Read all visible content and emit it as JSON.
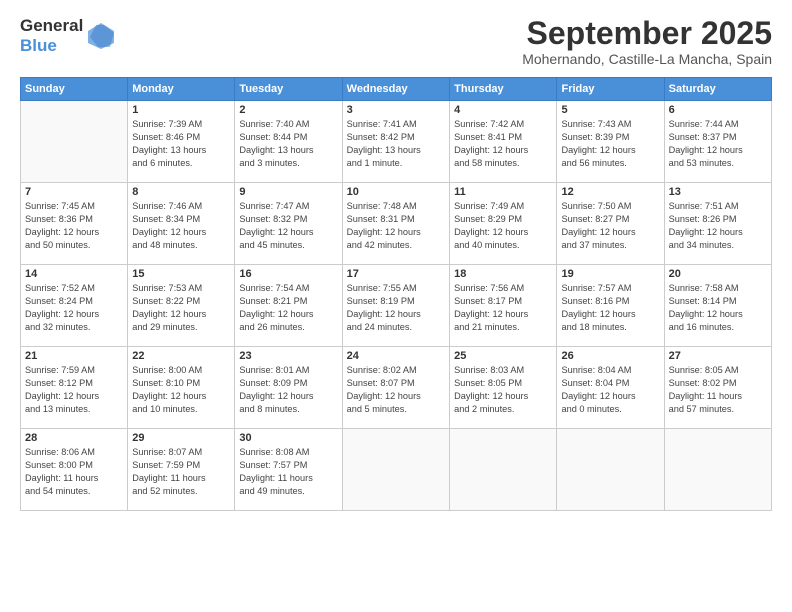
{
  "logo": {
    "general": "General",
    "blue": "Blue"
  },
  "title": "September 2025",
  "subtitle": "Mohernando, Castille-La Mancha, Spain",
  "header_days": [
    "Sunday",
    "Monday",
    "Tuesday",
    "Wednesday",
    "Thursday",
    "Friday",
    "Saturday"
  ],
  "weeks": [
    [
      {
        "day": "",
        "info": ""
      },
      {
        "day": "1",
        "info": "Sunrise: 7:39 AM\nSunset: 8:46 PM\nDaylight: 13 hours\nand 6 minutes."
      },
      {
        "day": "2",
        "info": "Sunrise: 7:40 AM\nSunset: 8:44 PM\nDaylight: 13 hours\nand 3 minutes."
      },
      {
        "day": "3",
        "info": "Sunrise: 7:41 AM\nSunset: 8:42 PM\nDaylight: 13 hours\nand 1 minute."
      },
      {
        "day": "4",
        "info": "Sunrise: 7:42 AM\nSunset: 8:41 PM\nDaylight: 12 hours\nand 58 minutes."
      },
      {
        "day": "5",
        "info": "Sunrise: 7:43 AM\nSunset: 8:39 PM\nDaylight: 12 hours\nand 56 minutes."
      },
      {
        "day": "6",
        "info": "Sunrise: 7:44 AM\nSunset: 8:37 PM\nDaylight: 12 hours\nand 53 minutes."
      }
    ],
    [
      {
        "day": "7",
        "info": "Sunrise: 7:45 AM\nSunset: 8:36 PM\nDaylight: 12 hours\nand 50 minutes."
      },
      {
        "day": "8",
        "info": "Sunrise: 7:46 AM\nSunset: 8:34 PM\nDaylight: 12 hours\nand 48 minutes."
      },
      {
        "day": "9",
        "info": "Sunrise: 7:47 AM\nSunset: 8:32 PM\nDaylight: 12 hours\nand 45 minutes."
      },
      {
        "day": "10",
        "info": "Sunrise: 7:48 AM\nSunset: 8:31 PM\nDaylight: 12 hours\nand 42 minutes."
      },
      {
        "day": "11",
        "info": "Sunrise: 7:49 AM\nSunset: 8:29 PM\nDaylight: 12 hours\nand 40 minutes."
      },
      {
        "day": "12",
        "info": "Sunrise: 7:50 AM\nSunset: 8:27 PM\nDaylight: 12 hours\nand 37 minutes."
      },
      {
        "day": "13",
        "info": "Sunrise: 7:51 AM\nSunset: 8:26 PM\nDaylight: 12 hours\nand 34 minutes."
      }
    ],
    [
      {
        "day": "14",
        "info": "Sunrise: 7:52 AM\nSunset: 8:24 PM\nDaylight: 12 hours\nand 32 minutes."
      },
      {
        "day": "15",
        "info": "Sunrise: 7:53 AM\nSunset: 8:22 PM\nDaylight: 12 hours\nand 29 minutes."
      },
      {
        "day": "16",
        "info": "Sunrise: 7:54 AM\nSunset: 8:21 PM\nDaylight: 12 hours\nand 26 minutes."
      },
      {
        "day": "17",
        "info": "Sunrise: 7:55 AM\nSunset: 8:19 PM\nDaylight: 12 hours\nand 24 minutes."
      },
      {
        "day": "18",
        "info": "Sunrise: 7:56 AM\nSunset: 8:17 PM\nDaylight: 12 hours\nand 21 minutes."
      },
      {
        "day": "19",
        "info": "Sunrise: 7:57 AM\nSunset: 8:16 PM\nDaylight: 12 hours\nand 18 minutes."
      },
      {
        "day": "20",
        "info": "Sunrise: 7:58 AM\nSunset: 8:14 PM\nDaylight: 12 hours\nand 16 minutes."
      }
    ],
    [
      {
        "day": "21",
        "info": "Sunrise: 7:59 AM\nSunset: 8:12 PM\nDaylight: 12 hours\nand 13 minutes."
      },
      {
        "day": "22",
        "info": "Sunrise: 8:00 AM\nSunset: 8:10 PM\nDaylight: 12 hours\nand 10 minutes."
      },
      {
        "day": "23",
        "info": "Sunrise: 8:01 AM\nSunset: 8:09 PM\nDaylight: 12 hours\nand 8 minutes."
      },
      {
        "day": "24",
        "info": "Sunrise: 8:02 AM\nSunset: 8:07 PM\nDaylight: 12 hours\nand 5 minutes."
      },
      {
        "day": "25",
        "info": "Sunrise: 8:03 AM\nSunset: 8:05 PM\nDaylight: 12 hours\nand 2 minutes."
      },
      {
        "day": "26",
        "info": "Sunrise: 8:04 AM\nSunset: 8:04 PM\nDaylight: 12 hours\nand 0 minutes."
      },
      {
        "day": "27",
        "info": "Sunrise: 8:05 AM\nSunset: 8:02 PM\nDaylight: 11 hours\nand 57 minutes."
      }
    ],
    [
      {
        "day": "28",
        "info": "Sunrise: 8:06 AM\nSunset: 8:00 PM\nDaylight: 11 hours\nand 54 minutes."
      },
      {
        "day": "29",
        "info": "Sunrise: 8:07 AM\nSunset: 7:59 PM\nDaylight: 11 hours\nand 52 minutes."
      },
      {
        "day": "30",
        "info": "Sunrise: 8:08 AM\nSunset: 7:57 PM\nDaylight: 11 hours\nand 49 minutes."
      },
      {
        "day": "",
        "info": ""
      },
      {
        "day": "",
        "info": ""
      },
      {
        "day": "",
        "info": ""
      },
      {
        "day": "",
        "info": ""
      }
    ]
  ]
}
